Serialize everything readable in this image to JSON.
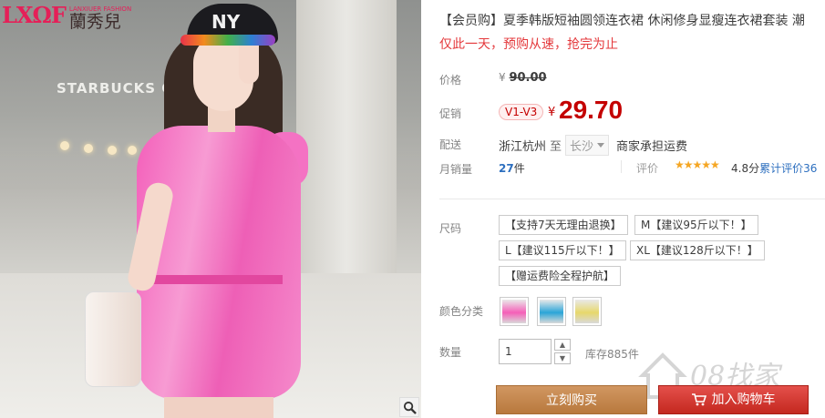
{
  "brand": {
    "logo_mark": "LXΩF",
    "logo_sub": "LANXIUER FASHION",
    "logo_cn": "蘭秀兒"
  },
  "photo": {
    "store_sign": "STARBUCKS CO",
    "cap_text": "NY"
  },
  "product": {
    "title": "【会员购】夏季韩版短袖圆领连衣裙 休闲修身显瘦连衣裙套装 潮",
    "subtitle": "仅此一天，预购从速，抢完为止"
  },
  "price": {
    "label": "价格",
    "currency": "¥",
    "original": "90.00",
    "promo_label": "促销",
    "badge": "V1-V3",
    "promo_currency": "¥",
    "promo": "29.70"
  },
  "shipping": {
    "label": "配送",
    "from": "浙江杭州",
    "to_word": "至",
    "to_city": "长沙",
    "note": "商家承担运费"
  },
  "sales": {
    "label": "月销量",
    "count": "27",
    "unit": "件",
    "rate_label": "评价",
    "stars": "★★★★★",
    "score": "4.8分",
    "total_label": "累计评价",
    "total": "36"
  },
  "size": {
    "label": "尺码",
    "options": [
      "【支持7天无理由退换】",
      "M【建议95斤以下！】",
      "L【建议115斤以下！】",
      "XL【建议128斤以下！】",
      "【赠运费险全程护航】"
    ]
  },
  "color": {
    "label": "颜色分类",
    "swatches": [
      "#f55fb8",
      "#2aa5d8",
      "#e7d86b"
    ]
  },
  "quantity": {
    "label": "数量",
    "value": "1",
    "stock": "库存885件"
  },
  "actions": {
    "buy_now": "立刻购买",
    "add_cart": "加入购物车"
  },
  "watermark": {
    "text": "08找家"
  },
  "colors": {
    "accent_red": "#c40000",
    "buy_brown": "#c68a4f",
    "cart_red": "#d83a32"
  }
}
